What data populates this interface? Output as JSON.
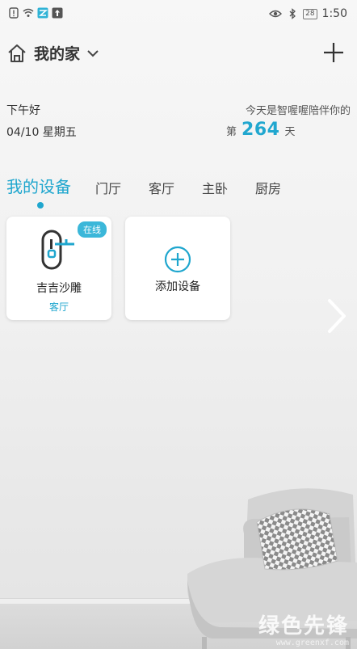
{
  "status_bar": {
    "time": "1:50",
    "battery": "28",
    "left_icons": [
      "alert-icon",
      "wifi-icon",
      "app-notification-icon",
      "upload-icon"
    ],
    "right_icons": [
      "eye-icon",
      "bluetooth-icon"
    ]
  },
  "header": {
    "home_name": "我的家",
    "icons": [
      "home-icon",
      "chevron-down-icon",
      "plus-icon"
    ]
  },
  "greeting": {
    "salutation": "下午好",
    "date": "04/10 星期五",
    "accompany_text": "今天是智喔喔陪伴你的",
    "day_prefix": "第",
    "day_count": "264",
    "day_suffix": "天"
  },
  "tabs": [
    {
      "label": "我的设备",
      "active": true
    },
    {
      "label": "门厅",
      "active": false
    },
    {
      "label": "客厅",
      "active": false
    },
    {
      "label": "主卧",
      "active": false
    },
    {
      "label": "厨房",
      "active": false
    }
  ],
  "devices": [
    {
      "name": "吉吉沙雕",
      "room": "客厅",
      "status": "在线",
      "icon": "smart-lock-icon"
    }
  ],
  "add_device": {
    "label": "添加设备",
    "icon": "plus-circle-icon"
  },
  "watermark": {
    "text": "绿色先锋",
    "url": "www.greenxf.com"
  },
  "colors": {
    "accent": "#1fa6ce",
    "badge": "#3bb7d9",
    "text": "#222222"
  }
}
